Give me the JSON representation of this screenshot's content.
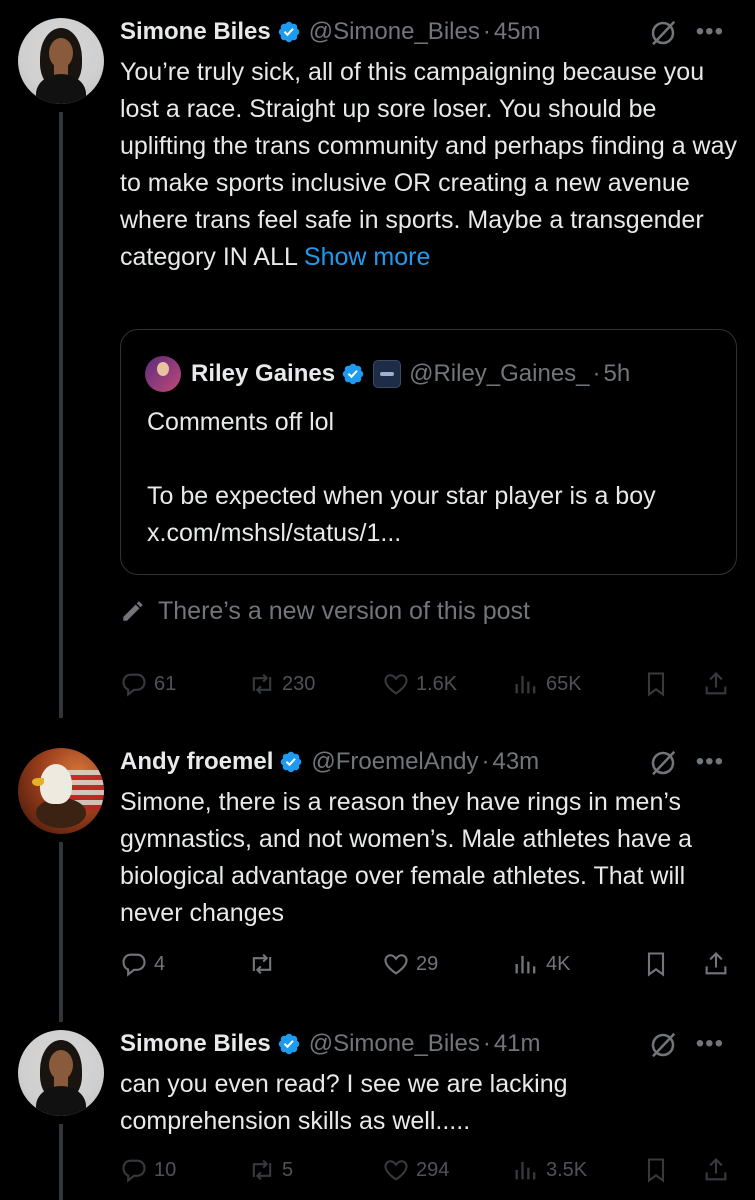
{
  "tweets": [
    {
      "name": "Simone Biles",
      "handle": "@Simone_Biles",
      "sep": "·",
      "time": "45m",
      "text": "You’re truly sick, all of this campaigning because you lost a race. Straight up sore loser. You should be uplifting the trans community and perhaps finding a way to make sports inclusive OR creating a new avenue where trans feel safe in sports. Maybe a transgender category IN ALL",
      "show_more": "Show more",
      "quote": {
        "name": "Riley Gaines",
        "handle": "@Riley_Gaines_",
        "sep": "·",
        "time": "5h",
        "text_line1": "Comments off lol",
        "text_line2": "To be expected when your star player is a boy x.com/mshsl/status/1..."
      },
      "new_version": "There’s a new version of this post",
      "stats": {
        "replies": "61",
        "reposts": "230",
        "likes": "1.6K",
        "views": "65K"
      }
    },
    {
      "name": "Andy froemel",
      "handle": "@FroemelAndy",
      "sep": "·",
      "time": "43m",
      "text": "Simone, there is a reason they have rings in men’s gymnastics, and not women’s. Male athletes have a biological advantage over female athletes. That will never changes",
      "stats": {
        "replies": "4",
        "reposts": "",
        "likes": "29",
        "views": "4K"
      }
    },
    {
      "name": "Simone Biles",
      "handle": "@Simone_Biles",
      "sep": "·",
      "time": "41m",
      "text": "can you even read? I see we are lacking comprehension skills as well.....",
      "stats": {
        "replies": "10",
        "reposts": "5",
        "likes": "294",
        "views": "3.5K"
      }
    }
  ],
  "icons": {
    "verified": "verified-badge-icon",
    "grok": "grok-icon",
    "more": "more-icon",
    "reply": "reply-icon",
    "repost": "repost-icon",
    "like": "heart-icon",
    "views": "views-icon",
    "bookmark": "bookmark-icon",
    "share": "share-icon",
    "pencil": "pencil-icon"
  },
  "colors": {
    "background": "#000000",
    "text": "#e7e9ea",
    "muted": "#71767b",
    "link": "#1d9bf0",
    "verified": "#1d9bf0"
  }
}
